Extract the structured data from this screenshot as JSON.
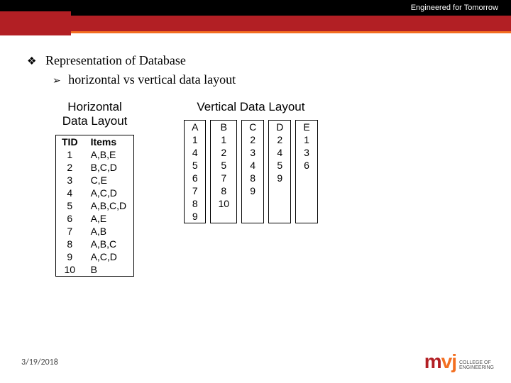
{
  "header": {
    "tagline": "Engineered for Tomorrow"
  },
  "bullets": {
    "l1": "Representation of Database",
    "l2": "horizontal vs vertical data layout"
  },
  "horizontal": {
    "title_line1": "Horizontal",
    "title_line2": "Data Layout",
    "col_tid": "TID",
    "col_items": "Items",
    "rows": [
      {
        "tid": "1",
        "items": "A,B,E"
      },
      {
        "tid": "2",
        "items": "B,C,D"
      },
      {
        "tid": "3",
        "items": "C,E"
      },
      {
        "tid": "4",
        "items": "A,C,D"
      },
      {
        "tid": "5",
        "items": "A,B,C,D"
      },
      {
        "tid": "6",
        "items": "A,E"
      },
      {
        "tid": "7",
        "items": "A,B"
      },
      {
        "tid": "8",
        "items": "A,B,C"
      },
      {
        "tid": "9",
        "items": "A,C,D"
      },
      {
        "tid": "10",
        "items": "B"
      }
    ]
  },
  "vertical": {
    "title": "Vertical Data Layout",
    "columns": [
      {
        "head": "A",
        "vals": [
          "1",
          "4",
          "5",
          "6",
          "7",
          "8",
          "9"
        ]
      },
      {
        "head": "B",
        "vals": [
          "1",
          "2",
          "5",
          "7",
          "8",
          "10"
        ]
      },
      {
        "head": "C",
        "vals": [
          "2",
          "3",
          "4",
          "8",
          "9"
        ]
      },
      {
        "head": "D",
        "vals": [
          "2",
          "4",
          "5",
          "9"
        ]
      },
      {
        "head": "E",
        "vals": [
          "1",
          "3",
          "6"
        ]
      }
    ]
  },
  "footer": {
    "date": "3/19/2018",
    "logo_m": "m",
    "logo_vj": "vj",
    "logo_sub1": "COLLEGE OF",
    "logo_sub2": "ENGINEERING"
  }
}
